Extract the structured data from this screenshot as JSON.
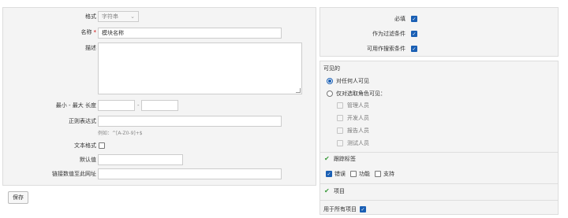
{
  "form": {
    "format_label": "格式",
    "format_value": "字符串",
    "name_label": "名称",
    "name_value": "模块名称",
    "description_label": "描述",
    "minmax_label": "最小 - 最大 长度",
    "minmax_sep": "-",
    "regex_label": "正则表达式",
    "regex_hint": "例如：^[A-Z0-9]+$",
    "textformat_label": "文本格式",
    "default_label": "默认值",
    "link_label": "链接数值至此网址",
    "save_label": "保存"
  },
  "flags": {
    "required_label": "必填",
    "filter_label": "作为过滤条件",
    "searchable_label": "可用作搜索条件"
  },
  "visibility": {
    "title": "可见的",
    "option_all": "对任何人可见",
    "option_roles": "仅对选取角色可见：",
    "roles": [
      "管理人员",
      "开发人员",
      "报告人员",
      "测试人员"
    ]
  },
  "trackers": {
    "title": "跟踪标签",
    "items": [
      "错误",
      "功能",
      "支持"
    ]
  },
  "projects": {
    "title": "项目",
    "all_label": "用于所有项目"
  },
  "colors": {
    "checkbox": "#1a5fb4",
    "check_icon": "#3a9a3a",
    "required_star": "#cc0000"
  }
}
